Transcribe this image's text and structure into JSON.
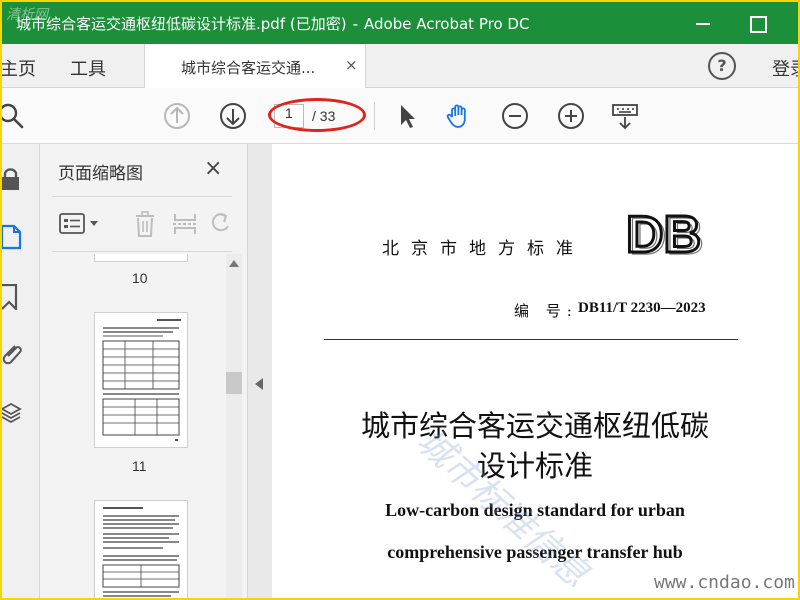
{
  "window": {
    "title": "城市综合客运交通枢纽低碳设计标准.pdf (已加密)",
    "separator": "-",
    "app_name": "Adobe Acrobat Pro DC",
    "corner_watermark": "清析网"
  },
  "menubar": {
    "home": "主页",
    "tools": "工具",
    "tab_label": "城市综合客运交通...",
    "tab_close": "×",
    "help": "?",
    "signin": "登录"
  },
  "toolbar": {
    "current_page": "1",
    "total_pages": "/ 33"
  },
  "panel": {
    "title": "页面缩略图",
    "close": "×",
    "thumb_labels": [
      "10",
      "11"
    ]
  },
  "document": {
    "org_name": "北京市地方标准",
    "logo_text": "DB",
    "number_label": "编 号:",
    "number": "DB11/T 2230—2023",
    "title_line1": "城市综合客运交通枢纽低碳",
    "title_line2": "设计标准",
    "english_line1": "Low-carbon design standard for urban",
    "english_line2": "comprehensive passenger transfer hub",
    "diagonal_watermark": "城市标准信息"
  },
  "site_watermark": "www.cndao.com",
  "colors": {
    "titlebar": "#1b8f3a",
    "border": "#f5d600",
    "highlight": "#e0231c",
    "active_tool": "#1a73e8"
  }
}
